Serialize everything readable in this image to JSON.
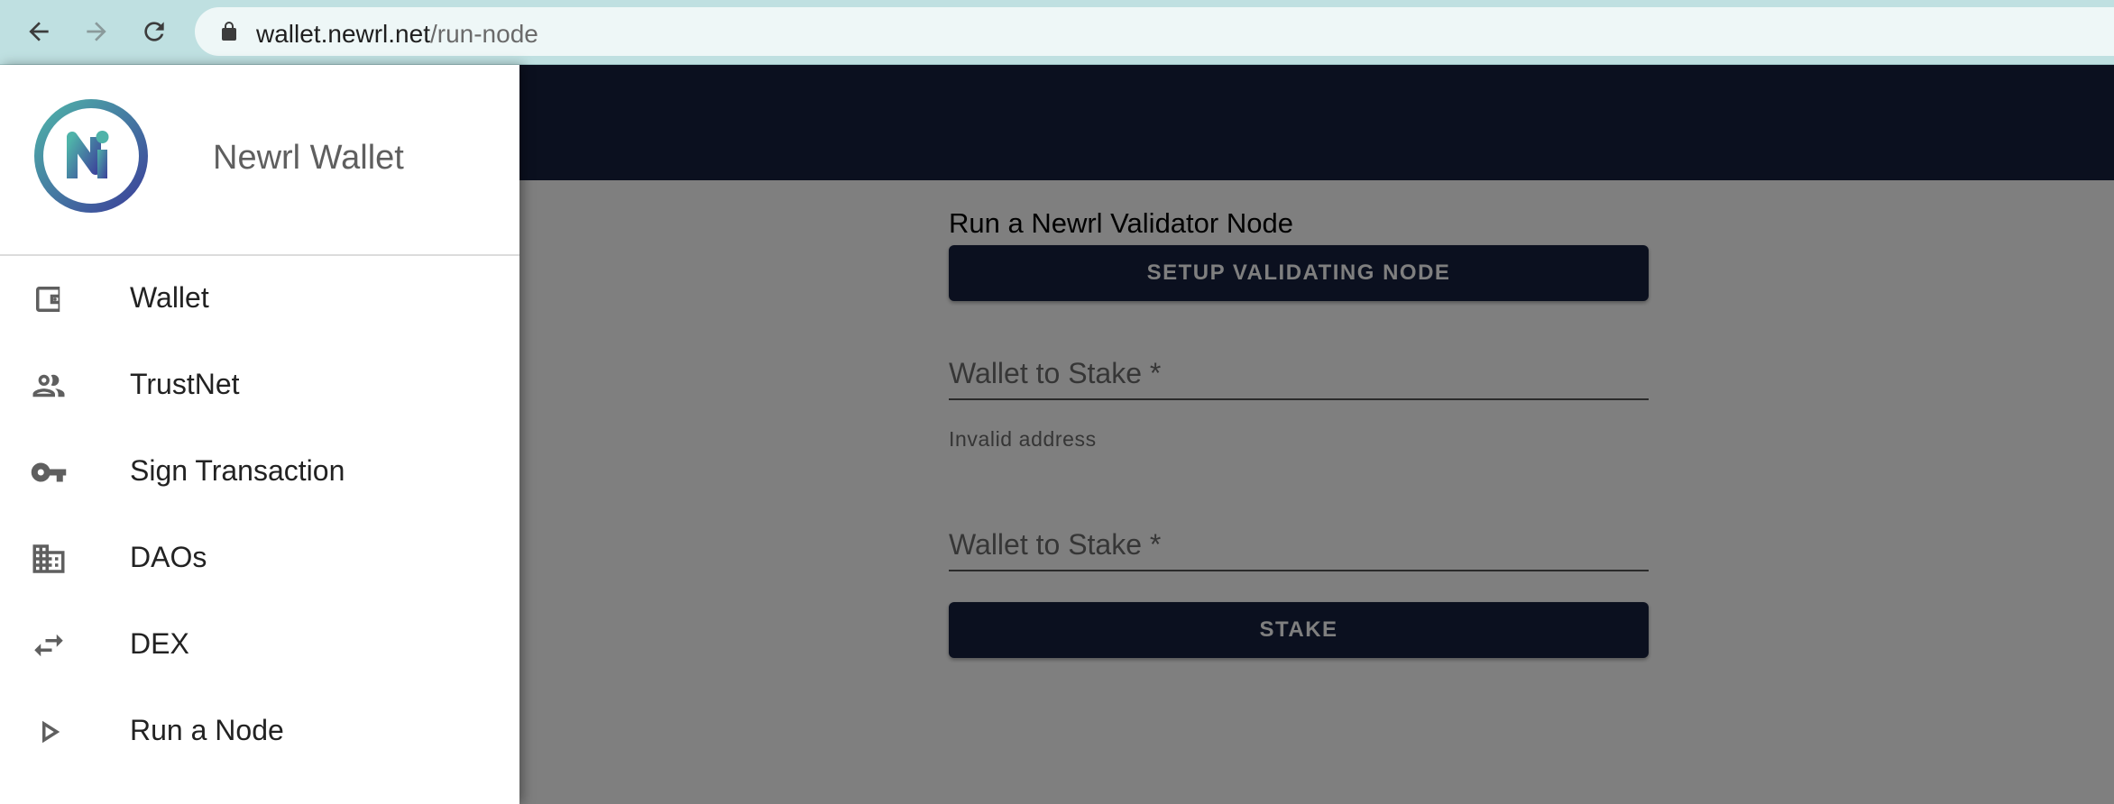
{
  "browser": {
    "url_host": "wallet.newrl.net",
    "url_path": "/run-node"
  },
  "drawer": {
    "brand": "Newrl Wallet",
    "items": [
      {
        "label": "Wallet",
        "icon": "wallet-icon"
      },
      {
        "label": "TrustNet",
        "icon": "people-icon"
      },
      {
        "label": "Sign Transaction",
        "icon": "key-icon"
      },
      {
        "label": "DAOs",
        "icon": "building-icon"
      },
      {
        "label": "DEX",
        "icon": "swap-icon"
      },
      {
        "label": "Run a Node",
        "icon": "play-icon"
      }
    ]
  },
  "main": {
    "title": "Run a Newrl Validator Node",
    "setup_button": "SETUP VALIDATING NODE",
    "stake_field_1_placeholder": "Wallet to Stake *",
    "stake_field_1_helper": "Invalid address",
    "stake_field_2_placeholder": "Wallet to Stake *",
    "stake_button": "STAKE"
  },
  "colors": {
    "header_bg": "#16213f",
    "button_bg": "#16213f",
    "browser_bar": "#bfe0e1",
    "logo_gradient_start": "#4fb3a9",
    "logo_gradient_end": "#3b4aa0"
  }
}
